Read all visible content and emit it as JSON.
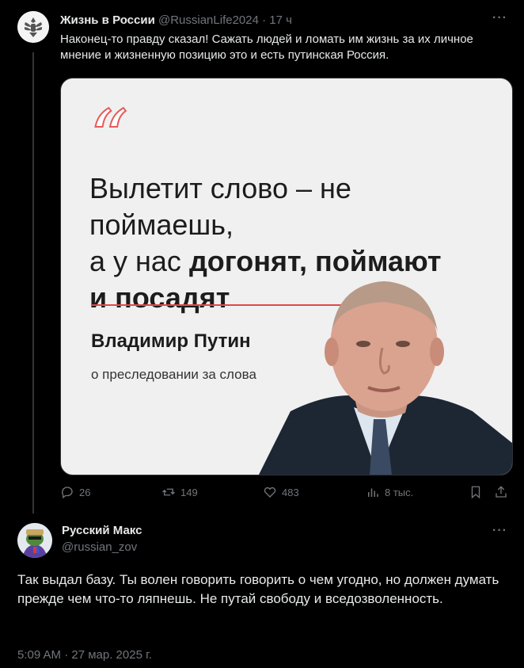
{
  "tweet1": {
    "author_name": "Жизнь в России",
    "handle": "@RussianLife2024",
    "time": "· 17 ч",
    "text": "Наконец-то правду сказал! Сажать людей и ломать им жизнь за их личное мнение и жизненную позицию это и есть путинская Россия.",
    "media": {
      "quote_line1": "Вылетит слово – не поймаешь,",
      "quote_line2_regular": "а у нас ",
      "quote_line2_bold": "догонят, поймают",
      "quote_line3_bold": "и посадят",
      "author": "Владимир Путин",
      "subtitle": "о преследовании за слова"
    },
    "actions": {
      "replies": "26",
      "reposts": "149",
      "likes": "483",
      "views": "8 тыс."
    }
  },
  "tweet2": {
    "author_name": "Русский Макс",
    "handle": "@russian_zov",
    "text": "Так выдал базу. Ты волен говорить говорить о чем угодно, но должен думать прежде чем что-то ляпнешь. Не путай свободу и вседозволенность.",
    "timestamp": "5:09 AM · 27 мар. 2025 г."
  },
  "icons": {
    "more": "more-icon",
    "reply": "reply-icon",
    "repost": "repost-icon",
    "like": "like-icon",
    "views": "views-icon",
    "bookmark": "bookmark-icon",
    "share": "share-icon"
  },
  "colors": {
    "background": "#000000",
    "text": "#e7e9ea",
    "muted": "#71767b",
    "quote_accent": "#e04848"
  }
}
